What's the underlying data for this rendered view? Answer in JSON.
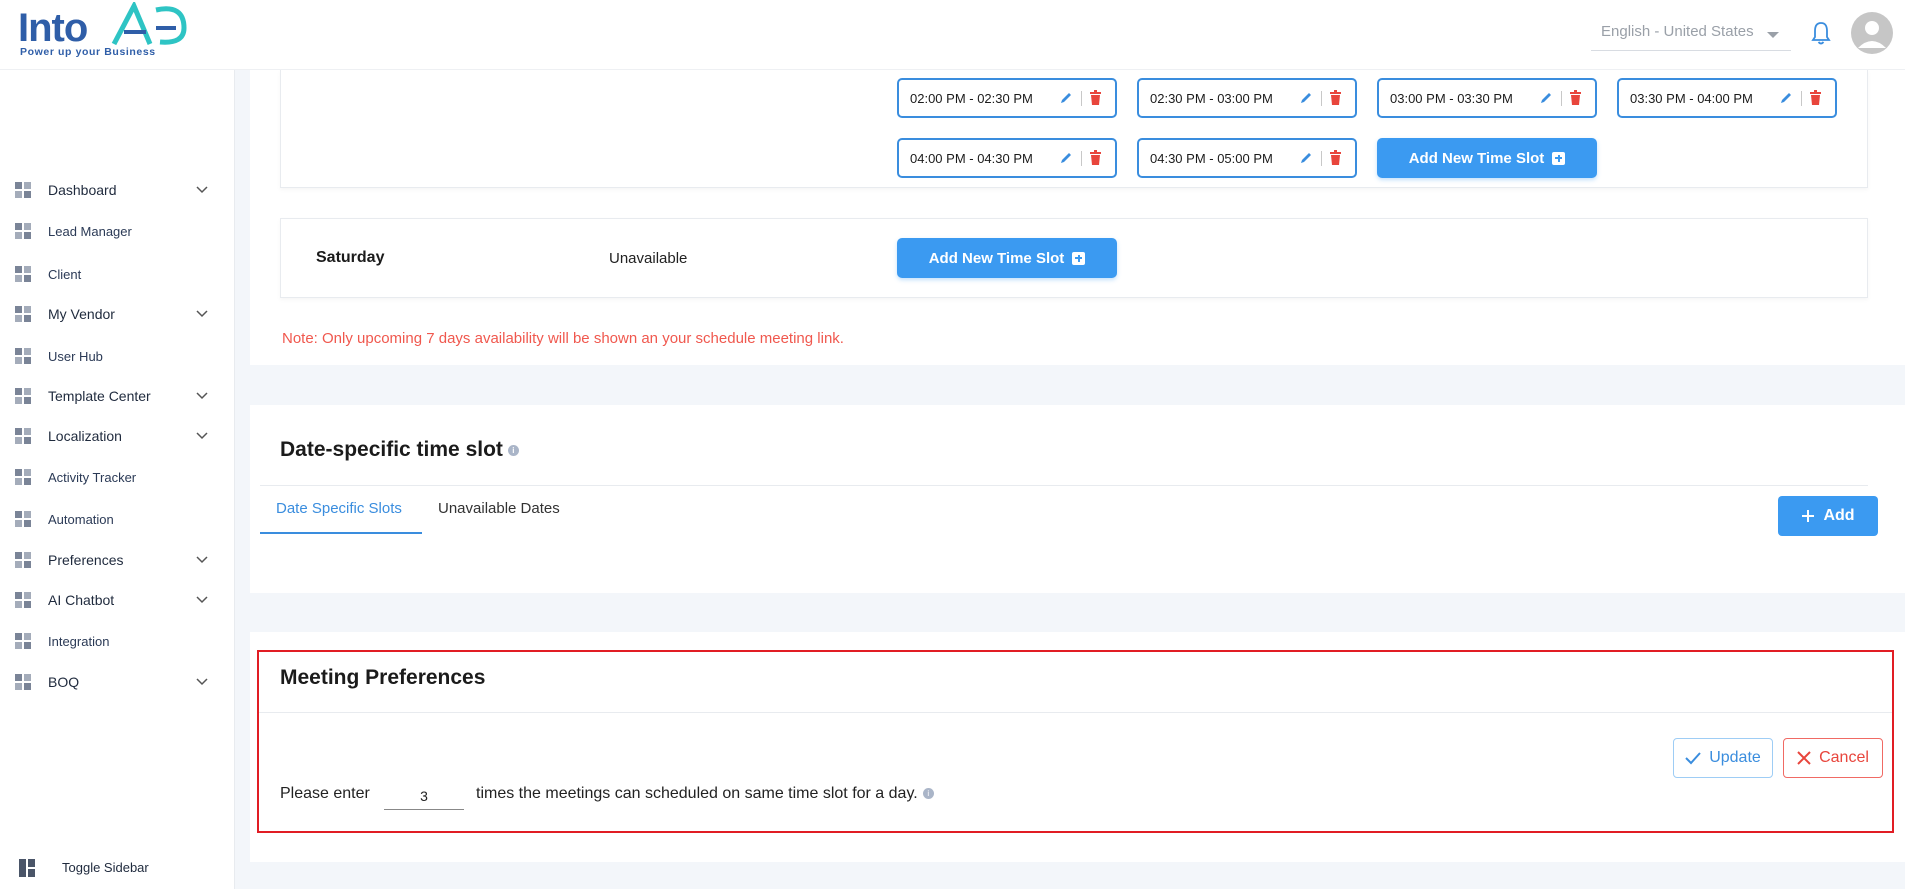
{
  "header": {
    "logo_text": "IntoAEC",
    "logo_tagline": "Power up your Business",
    "language": "English - United States"
  },
  "sidebar": {
    "items": [
      {
        "label": "Dashboard",
        "icon": "dashboard-icon",
        "expandable": true
      },
      {
        "label": "Lead Manager",
        "icon": "lead-manager-icon",
        "expandable": false
      },
      {
        "label": "Client",
        "icon": "client-icon",
        "expandable": false
      },
      {
        "label": "My Vendor",
        "icon": "vendor-icon",
        "expandable": true
      },
      {
        "label": "User Hub",
        "icon": "user-icon",
        "expandable": false
      },
      {
        "label": "Template Center",
        "icon": "template-icon",
        "expandable": true
      },
      {
        "label": "Localization",
        "icon": "localization-icon",
        "expandable": true
      },
      {
        "label": "Activity Tracker",
        "icon": "activity-icon",
        "expandable": false
      },
      {
        "label": "Automation",
        "icon": "automation-icon",
        "expandable": false
      },
      {
        "label": "Preferences",
        "icon": "preferences-icon",
        "expandable": true
      },
      {
        "label": "AI Chatbot",
        "icon": "chatbot-icon",
        "expandable": true
      },
      {
        "label": "Integration",
        "icon": "integration-icon",
        "expandable": false
      },
      {
        "label": "BOQ",
        "icon": "boq-icon",
        "expandable": true
      }
    ],
    "toggle_label": "Toggle Sidebar"
  },
  "time_slots": {
    "row1": [
      "02:00 PM - 02:30 PM",
      "02:30 PM - 03:00 PM",
      "03:00 PM - 03:30 PM",
      "03:30 PM - 04:00 PM"
    ],
    "row2": [
      "04:00 PM - 04:30 PM",
      "04:30 PM - 05:00 PM"
    ],
    "add_label": "Add New Time Slot"
  },
  "saturday": {
    "day": "Saturday",
    "status": "Unavailable",
    "add_label": "Add New Time Slot"
  },
  "note": "Note: Only upcoming 7 days availability will be shown an your schedule meeting link.",
  "date_specific": {
    "title": "Date-specific time slot",
    "tabs": [
      "Date Specific Slots",
      "Unavailable Dates"
    ],
    "add_label": "Add"
  },
  "meeting_preferences": {
    "title": "Meeting Preferences",
    "text_before": "Please enter",
    "value": "3",
    "text_after": "times the meetings can scheduled on same time slot for a day.",
    "update_label": "Update",
    "cancel_label": "Cancel"
  },
  "colors": {
    "primary": "#3b9af1",
    "danger": "#e8453c",
    "note": "#f0584e"
  }
}
